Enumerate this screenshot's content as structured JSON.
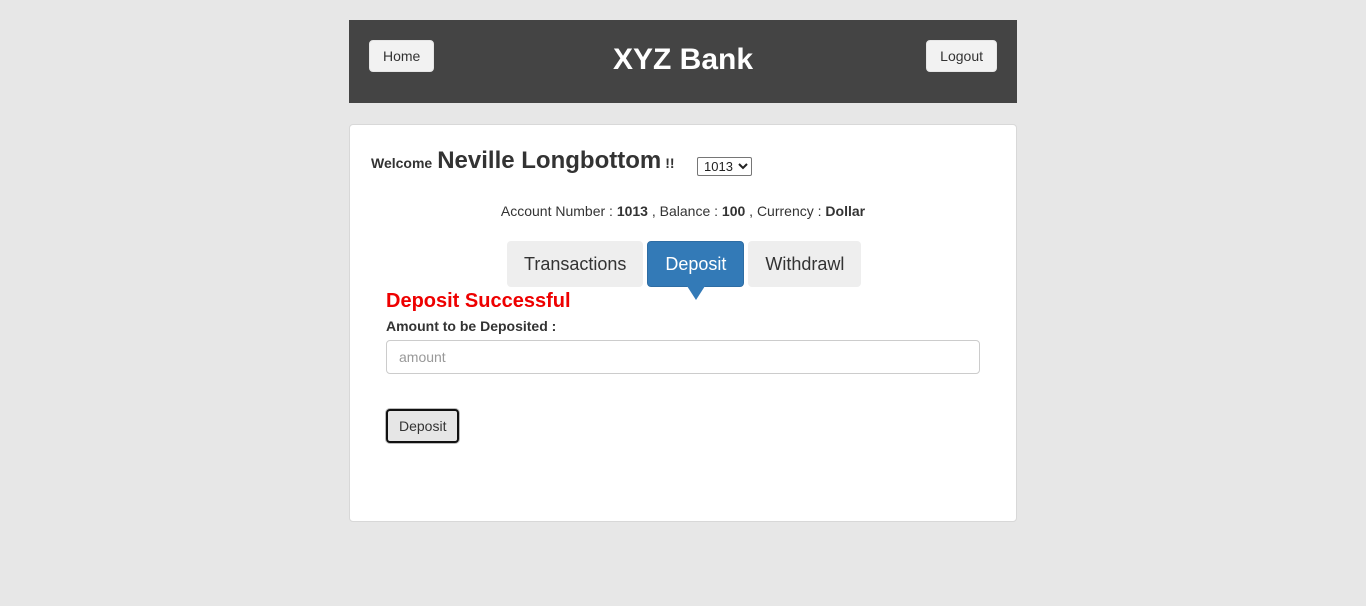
{
  "header": {
    "title": "XYZ Bank",
    "home_label": "Home",
    "logout_label": "Logout"
  },
  "customer": {
    "welcome_label": "Welcome",
    "name": "Neville Longbottom",
    "exclaim": "!!",
    "selected_account": "1013"
  },
  "account_info": {
    "number_label": "Account Number :",
    "number": "1013",
    "balance_label": ", Balance :",
    "balance": "100",
    "currency_label": ", Currency :",
    "currency": "Dollar"
  },
  "tabs": [
    {
      "label": "Transactions",
      "active": false
    },
    {
      "label": "Deposit",
      "active": true
    },
    {
      "label": "Withdrawl",
      "active": false
    }
  ],
  "deposit_form": {
    "message": "Deposit Successful",
    "amount_label": "Amount to be Deposited :",
    "amount_value": "",
    "amount_placeholder": "amount",
    "submit_label": "Deposit"
  },
  "colors": {
    "header_bg": "#444444",
    "active_tab": "#337ab7",
    "success_message": "#ee0000",
    "page_bg": "#e7e7e7"
  }
}
